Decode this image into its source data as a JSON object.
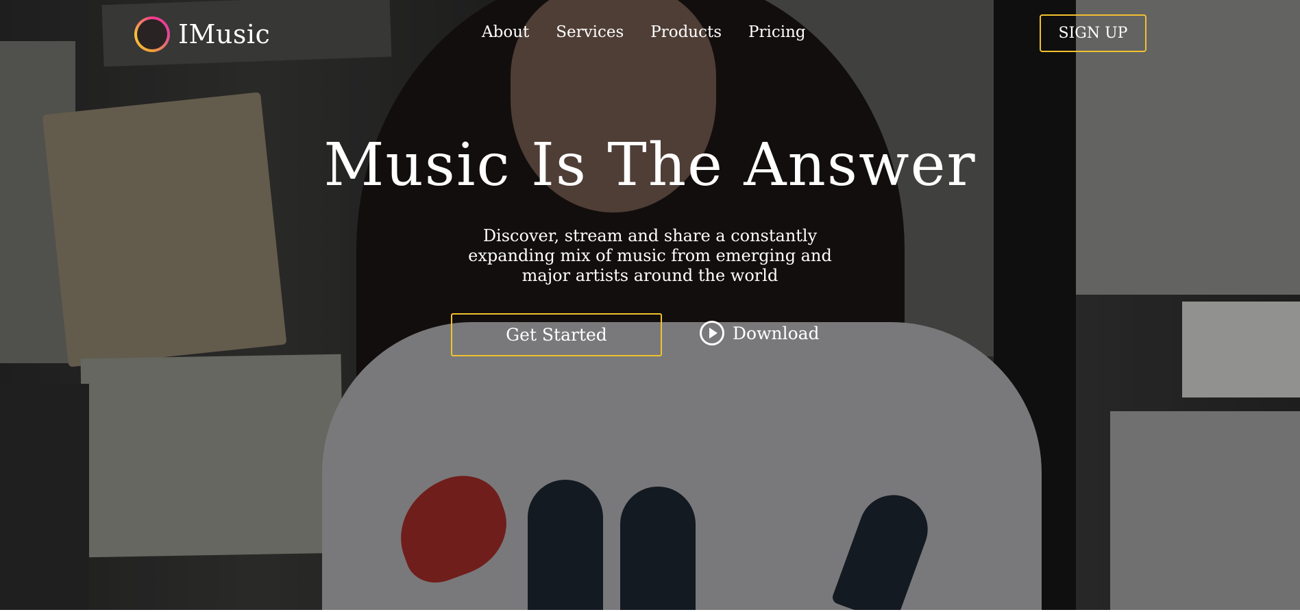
{
  "brand": {
    "name": "IMusic",
    "logo_icon": "soundwave-icon",
    "logo_gradient": [
      "#f03a8e",
      "#f8c338"
    ]
  },
  "nav": {
    "items": [
      {
        "label": "About"
      },
      {
        "label": "Services"
      },
      {
        "label": "Products"
      },
      {
        "label": "Pricing"
      }
    ]
  },
  "header": {
    "signup_label": "SIGN UP"
  },
  "hero": {
    "headline": "Music Is The Answer",
    "subtext": "Discover, stream and share a constantly expanding mix of music from emerging and major artists around the world",
    "primary_cta": "Get Started",
    "secondary_cta": "Download",
    "secondary_icon": "play-circle-icon"
  },
  "colors": {
    "accent": "#f2c12e",
    "text": "#ffffff"
  }
}
